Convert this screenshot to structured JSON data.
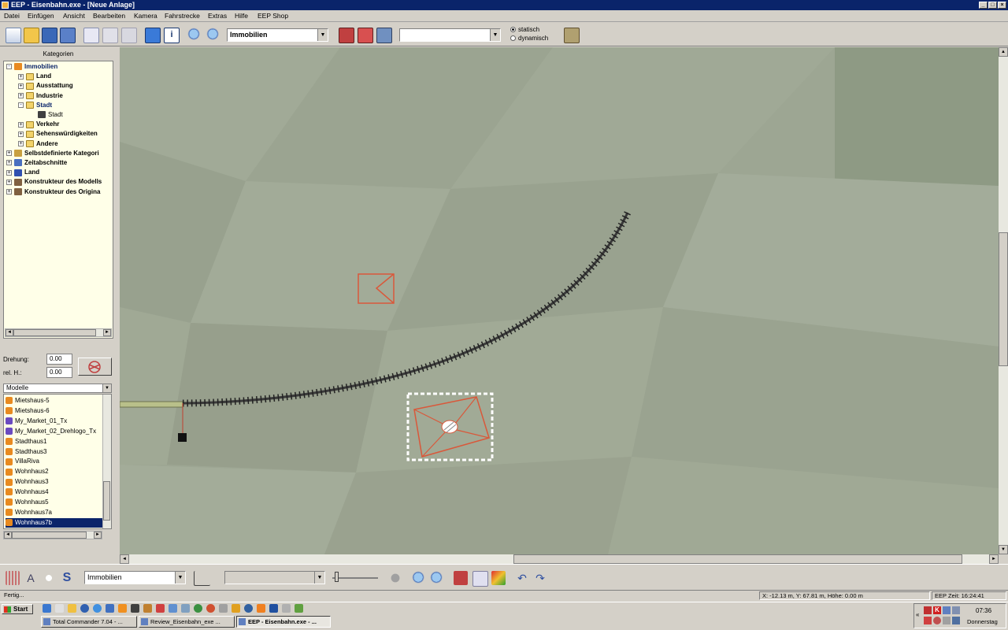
{
  "window": {
    "title": "EEP - Eisenbahn.exe - [Neue Anlage]"
  },
  "menu": [
    "Datei",
    "Einfügen",
    "Ansicht",
    "Bearbeiten",
    "Kamera",
    "Fahrstrecke",
    "Extras",
    "Hilfe",
    "EEP Shop"
  ],
  "toolbar": {
    "category_combo": "Immobilien",
    "second_combo": "",
    "radio_static": "statisch",
    "radio_dynamic": "dynamisch",
    "radio_selected": "statisch"
  },
  "kategorien": {
    "title": "Kategorien",
    "tree": [
      {
        "label": "Immobilien",
        "level": 0,
        "expand": "-",
        "selected": true,
        "icon": "house-icon"
      },
      {
        "label": "Land",
        "level": 1,
        "expand": "+",
        "icon": "folder-icon"
      },
      {
        "label": "Ausstattung",
        "level": 1,
        "expand": "+",
        "icon": "folder-icon"
      },
      {
        "label": "Industrie",
        "level": 1,
        "expand": "+",
        "icon": "folder-icon"
      },
      {
        "label": "Stadt",
        "level": 1,
        "expand": "-",
        "selected": true,
        "icon": "folder-open-icon"
      },
      {
        "label": "Stadt",
        "level": 2,
        "expand": "",
        "icon": "building-icon"
      },
      {
        "label": "Verkehr",
        "level": 1,
        "expand": "+",
        "icon": "folder-icon"
      },
      {
        "label": "Sehenswürdigkeiten",
        "level": 1,
        "expand": "+",
        "icon": "folder-icon"
      },
      {
        "label": "Andere",
        "level": 1,
        "expand": "+",
        "icon": "folder-icon"
      },
      {
        "label": "Selbstdefinierte Kategori",
        "level": 0,
        "expand": "+",
        "icon": "user-folder-icon"
      },
      {
        "label": "Zeitabschnitte",
        "level": 0,
        "expand": "+",
        "icon": "clock-icon"
      },
      {
        "label": "Land",
        "level": 0,
        "expand": "+",
        "icon": "flag-icon"
      },
      {
        "label": "Konstrukteur des Modells",
        "level": 0,
        "expand": "+",
        "icon": "person-icon"
      },
      {
        "label": "Konstrukteur des Origina",
        "level": 0,
        "expand": "+",
        "icon": "person-icon"
      }
    ]
  },
  "props": {
    "drehung_label": "Drehung:",
    "drehung_value": "0.00",
    "relh_label": "rel. H.:",
    "relh_value": "0.00"
  },
  "modelle": {
    "header": "Modelle",
    "items": [
      "Mietshaus-5",
      "Mietshaus-6",
      "My_Market_01_Tx",
      "My_Market_02_Drehlogo_Tx",
      "Stadthaus1",
      "Stadthaus3",
      "VillaRiva",
      "Wohnhaus2",
      "Wohnhaus3",
      "Wohnhaus4",
      "Wohnhaus5",
      "Wohnhaus7a",
      "Wohnhaus7b"
    ],
    "selected": "Wohnhaus7b"
  },
  "bottom_toolbar": {
    "category_combo": "Immobilien",
    "second_combo": ""
  },
  "status": {
    "message": "Fertig...",
    "coords": "X: -12.13 m, Y: 67.81 m, Höhe: 0.00 m",
    "eep_time": "EEP Zeit: 16:24:41"
  },
  "taskbar": {
    "start": "Start",
    "tasks": [
      {
        "label": "Total Commander 7.04 - ...",
        "active": false
      },
      {
        "label": "Review_Eisenbahn_exe ...",
        "active": false
      },
      {
        "label": "EEP - Eisenbahn.exe - ...",
        "active": true
      }
    ],
    "clock": "07:36",
    "day": "Donnerstag"
  },
  "colors": {
    "titlebar": "#0a246a",
    "canvas": "#9ca592",
    "tree_bg": "#ffffe8",
    "outline": "#d9583a",
    "selection": "#0a246a"
  }
}
